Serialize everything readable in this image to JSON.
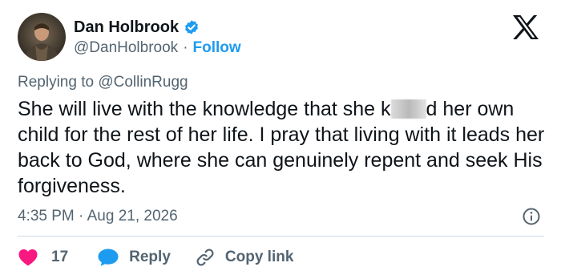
{
  "author": {
    "name": "Dan Holbrook",
    "handle": "@DanHolbrook",
    "separator": "·",
    "follow_label": "Follow"
  },
  "reply_context": {
    "prefix": "Replying to",
    "mention": "@CollinRugg"
  },
  "tweet": {
    "text_before_censor": "She will live with the knowledge that she k",
    "text_after_censor": "d her own child for the rest of her life. I pray that living with it leads her back to God, where she can genuinely repent and seek His forgiveness."
  },
  "meta": {
    "time": "4:35 PM",
    "separator": "·",
    "date": "Aug 21, 2026"
  },
  "actions": {
    "like_count": "17",
    "reply_label": "Reply",
    "copy_link_label": "Copy link"
  },
  "colors": {
    "text": "#0f1419",
    "secondary": "#536471",
    "link": "#1d9bf0",
    "like": "#f91880",
    "reply": "#1d9bf0",
    "divider": "#cfd9de"
  },
  "icons": {
    "avatar": "avatar-photo",
    "verified": "verified-badge-icon",
    "brand": "x-logo-icon",
    "info": "info-icon",
    "like": "heart-icon",
    "reply": "speech-bubble-icon",
    "copy": "link-icon"
  }
}
